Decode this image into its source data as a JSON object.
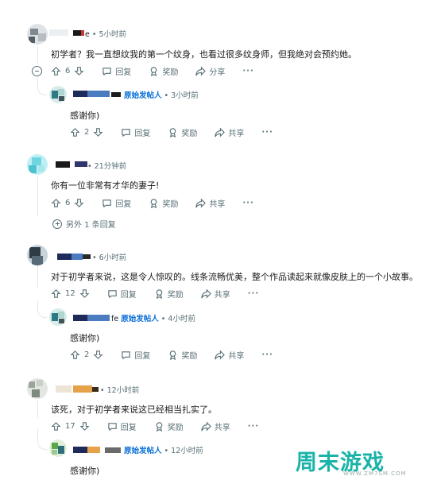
{
  "comments": [
    {
      "time": "5小时前",
      "body": "初学者？我一直想纹我的第一个纹身，也看过很多纹身师，但我绝对会预约她。",
      "votes": "6",
      "reply_label": "回复",
      "award_label": "奖励",
      "share_label": "分享",
      "more_label": "···",
      "replies": [
        {
          "op_badge": "原始发帖人",
          "time": "3小时前",
          "body": "感谢你)",
          "votes": "2",
          "reply_label": "回复",
          "award_label": "奖励",
          "share_label": "共享",
          "more_label": "···"
        }
      ]
    },
    {
      "time": "21分钟前",
      "body": "你有一位非常有才华的妻子!",
      "votes": "6",
      "reply_label": "回复",
      "award_label": "奖励",
      "share_label": "共享",
      "more_label": "···",
      "more_replies": "另外 1 条回复"
    },
    {
      "time": "6小时前",
      "body": "对于初学者来说，这是令人惊叹的。线条流畅优美，整个作品读起来就像皮肤上的一个小故事。",
      "votes": "12",
      "reply_label": "回复",
      "award_label": "奖励",
      "share_label": "共享",
      "more_label": "···",
      "replies": [
        {
          "name_fragment": "fe",
          "op_badge": "原始发帖人",
          "time": "4小时前",
          "body": "感谢你)",
          "votes": "2",
          "reply_label": "回复",
          "award_label": "奖励",
          "share_label": "共享",
          "more_label": "···"
        }
      ]
    },
    {
      "time": "12小时前",
      "body": "该死，对于初学者来说这已经相当扎实了。",
      "votes": "17",
      "reply_label": "回复",
      "award_label": "奖励",
      "share_label": "共享",
      "more_label": "···",
      "replies": [
        {
          "op_badge": "原始发帖人",
          "time": "12小时前",
          "body": "感谢你)"
        }
      ]
    }
  ],
  "watermark": {
    "title": "周末游戏",
    "url": "WWW.ZM7SM.COM"
  },
  "colors": {
    "op_badge": "#0a6fd8",
    "meta": "#576f76",
    "thread_line": "#e4e7e9",
    "watermark": "#19b3a8"
  }
}
